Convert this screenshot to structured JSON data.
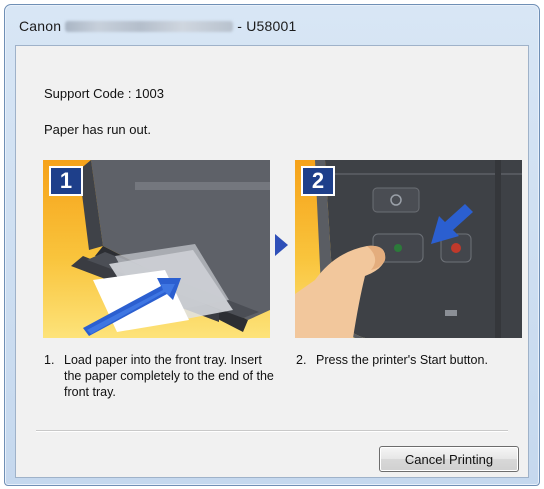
{
  "window": {
    "title_prefix": "Canon",
    "title_suffix": "- U58001"
  },
  "dialog": {
    "support_code": "Support Code : 1003",
    "message": "Paper has run out."
  },
  "steps": [
    {
      "badge": "1",
      "number": "1.",
      "text": "Load paper into the front tray. Insert the paper completely to the end of the front tray."
    },
    {
      "badge": "2",
      "number": "2.",
      "text": "Press the printer's Start button."
    }
  ],
  "buttons": {
    "cancel_label": "Cancel Printing"
  },
  "colors": {
    "panel_orange": "#f6a21a",
    "panel_yellow": "#fde37a",
    "badge_blue": "#1e3f8a",
    "start_green": "#2c7a3a",
    "stop_red": "#c0392b"
  }
}
